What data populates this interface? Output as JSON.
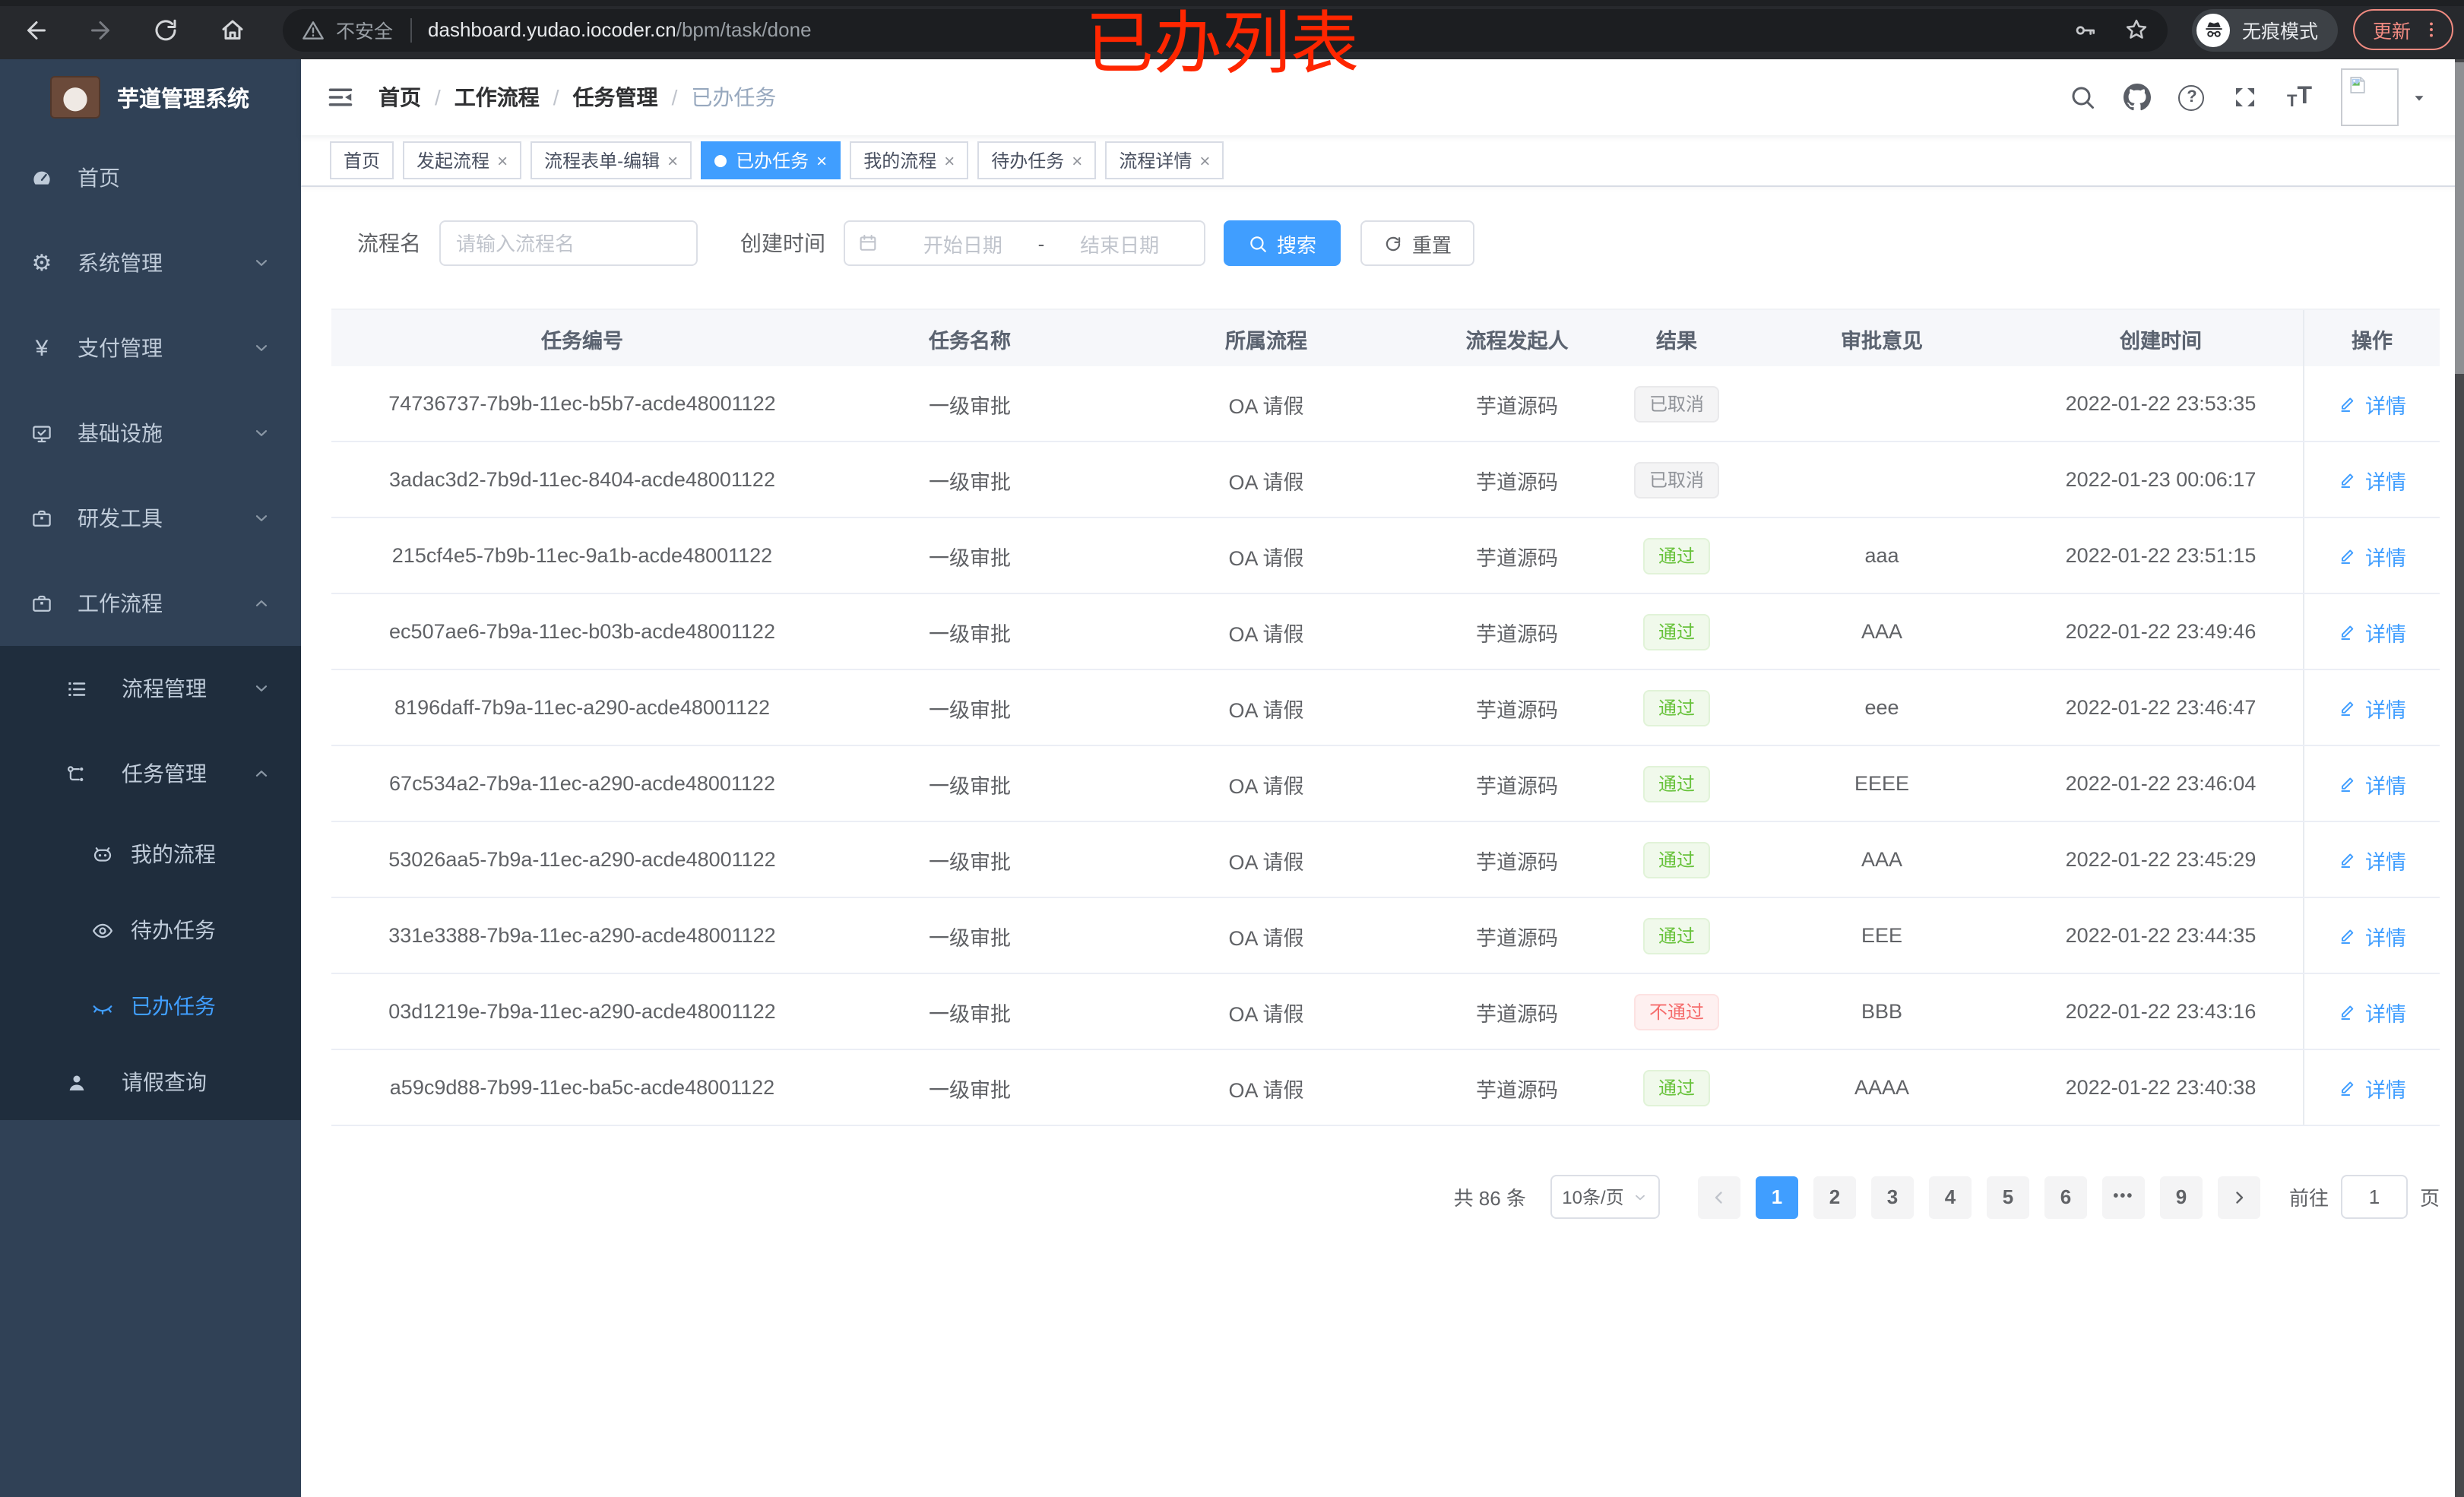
{
  "browser": {
    "security_label": "不安全",
    "url_host": "dashboard.yudao.iocoder.cn",
    "url_path": "/bpm/task/done",
    "incognito_label": "无痕模式",
    "update_label": "更新"
  },
  "annotation": {
    "text": "已办列表",
    "color": "#ff2600"
  },
  "sidebar": {
    "title": "芋道管理系统",
    "items": [
      {
        "key": "home",
        "label": "首页",
        "icon": "gauge-icon",
        "level": 1
      },
      {
        "key": "system",
        "label": "系统管理",
        "icon": "gear-icon",
        "level": 1,
        "chevron": "down"
      },
      {
        "key": "payment",
        "label": "支付管理",
        "icon": "yen-icon",
        "level": 1,
        "chevron": "down"
      },
      {
        "key": "infra",
        "label": "基础设施",
        "icon": "monitor-icon",
        "level": 1,
        "chevron": "down"
      },
      {
        "key": "devtools",
        "label": "研发工具",
        "icon": "briefcase-icon",
        "level": 1,
        "chevron": "down"
      },
      {
        "key": "workflow",
        "label": "工作流程",
        "icon": "briefcase-icon",
        "level": 1,
        "chevron": "up"
      },
      {
        "key": "process-mgmt",
        "label": "流程管理",
        "icon": "list-icon",
        "level": 2,
        "chevron": "down",
        "inSub": true
      },
      {
        "key": "task-mgmt",
        "label": "任务管理",
        "icon": "flow-icon",
        "level": 2,
        "chevron": "up",
        "inSub": true
      },
      {
        "key": "my-process",
        "label": "我的流程",
        "icon": "face-icon",
        "level": 3,
        "inSub": true
      },
      {
        "key": "todo-tasks",
        "label": "待办任务",
        "icon": "eye-icon",
        "level": 3,
        "inSub": true
      },
      {
        "key": "done-tasks",
        "label": "已办任务",
        "icon": "eye-closed-icon",
        "level": 3,
        "inSub": true,
        "active": true
      },
      {
        "key": "leave-query",
        "label": "请假查询",
        "icon": "user-icon",
        "level": 2,
        "inSub": true,
        "short": true
      }
    ]
  },
  "breadcrumb": {
    "items": [
      "首页",
      "工作流程",
      "任务管理",
      "已办任务"
    ],
    "separator": "/"
  },
  "tabs": [
    {
      "key": "home",
      "label": "首页",
      "closable": false
    },
    {
      "key": "start-process",
      "label": "发起流程",
      "closable": true
    },
    {
      "key": "form-edit",
      "label": "流程表单-编辑",
      "closable": true
    },
    {
      "key": "done-tasks",
      "label": "已办任务",
      "closable": true,
      "active": true
    },
    {
      "key": "my-process",
      "label": "我的流程",
      "closable": true
    },
    {
      "key": "todo-tasks",
      "label": "待办任务",
      "closable": true
    },
    {
      "key": "process-detail",
      "label": "流程详情",
      "closable": true
    }
  ],
  "ui": {
    "close_glyph": "×",
    "font_icon_small": "T",
    "font_icon_big": "T"
  },
  "filters": {
    "name_label": "流程名",
    "name_placeholder": "请输入流程名",
    "date_label": "创建时间",
    "date_start_placeholder": "开始日期",
    "date_separator": "-",
    "date_end_placeholder": "结束日期",
    "search_label": "搜索",
    "reset_label": "重置"
  },
  "table": {
    "columns": [
      "任务编号",
      "任务名称",
      "所属流程",
      "流程发起人",
      "结果",
      "审批意见",
      "创建时间",
      "操作"
    ],
    "action_label": "详情",
    "rows": [
      {
        "id": "74736737-7b9b-11ec-b5b7-acde48001122",
        "name": "一级审批",
        "process": "OA 请假",
        "starter": "芋道源码",
        "result": "已取消",
        "result_type": "info",
        "comment": "",
        "time": "2022-01-22 23:53:35"
      },
      {
        "id": "3adac3d2-7b9d-11ec-8404-acde48001122",
        "name": "一级审批",
        "process": "OA 请假",
        "starter": "芋道源码",
        "result": "已取消",
        "result_type": "info",
        "comment": "",
        "time": "2022-01-23 00:06:17"
      },
      {
        "id": "215cf4e5-7b9b-11ec-9a1b-acde48001122",
        "name": "一级审批",
        "process": "OA 请假",
        "starter": "芋道源码",
        "result": "通过",
        "result_type": "success",
        "comment": "aaa",
        "time": "2022-01-22 23:51:15"
      },
      {
        "id": "ec507ae6-7b9a-11ec-b03b-acde48001122",
        "name": "一级审批",
        "process": "OA 请假",
        "starter": "芋道源码",
        "result": "通过",
        "result_type": "success",
        "comment": "AAA",
        "time": "2022-01-22 23:49:46"
      },
      {
        "id": "8196daff-7b9a-11ec-a290-acde48001122",
        "name": "一级审批",
        "process": "OA 请假",
        "starter": "芋道源码",
        "result": "通过",
        "result_type": "success",
        "comment": "eee",
        "time": "2022-01-22 23:46:47"
      },
      {
        "id": "67c534a2-7b9a-11ec-a290-acde48001122",
        "name": "一级审批",
        "process": "OA 请假",
        "starter": "芋道源码",
        "result": "通过",
        "result_type": "success",
        "comment": "EEEE",
        "time": "2022-01-22 23:46:04"
      },
      {
        "id": "53026aa5-7b9a-11ec-a290-acde48001122",
        "name": "一级审批",
        "process": "OA 请假",
        "starter": "芋道源码",
        "result": "通过",
        "result_type": "success",
        "comment": "AAA",
        "time": "2022-01-22 23:45:29"
      },
      {
        "id": "331e3388-7b9a-11ec-a290-acde48001122",
        "name": "一级审批",
        "process": "OA 请假",
        "starter": "芋道源码",
        "result": "通过",
        "result_type": "success",
        "comment": "EEE",
        "time": "2022-01-22 23:44:35"
      },
      {
        "id": "03d1219e-7b9a-11ec-a290-acde48001122",
        "name": "一级审批",
        "process": "OA 请假",
        "starter": "芋道源码",
        "result": "不通过",
        "result_type": "danger",
        "comment": "BBB",
        "time": "2022-01-22 23:43:16"
      },
      {
        "id": "a59c9d88-7b99-11ec-ba5c-acde48001122",
        "name": "一级审批",
        "process": "OA 请假",
        "starter": "芋道源码",
        "result": "通过",
        "result_type": "success",
        "comment": "AAAA",
        "time": "2022-01-22 23:40:38"
      }
    ]
  },
  "pagination": {
    "total_label": "共 86 条",
    "page_size_label": "10条/页",
    "pages": [
      {
        "label": "1",
        "active": true
      },
      {
        "label": "2"
      },
      {
        "label": "3"
      },
      {
        "label": "4"
      },
      {
        "label": "5"
      },
      {
        "label": "6"
      },
      {
        "label": "•••",
        "ellipsis": true
      },
      {
        "label": "9"
      }
    ],
    "goto_label": "前往",
    "goto_value": "1",
    "unit_label": "页"
  },
  "colors": {
    "accent": "#409eff",
    "success": "#67c23a",
    "danger": "#f56c6c",
    "info": "#909399",
    "sidebar_bg": "#304156",
    "submenu_bg": "#1f2d3d",
    "annotation": "#ff2600",
    "update_button": "#f28b82"
  }
}
